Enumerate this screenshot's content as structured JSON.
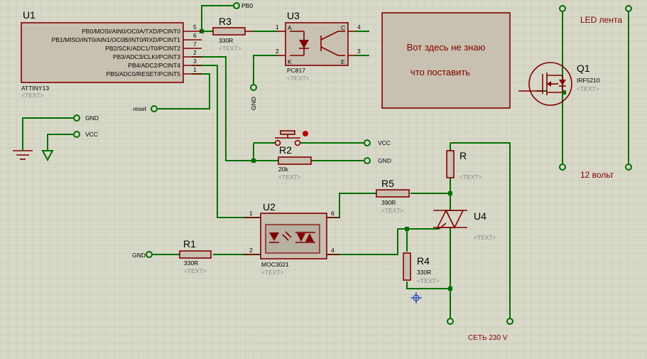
{
  "colors": {
    "background": "#d8d8c8",
    "grid": "#c6c6b6",
    "wire": "#007000",
    "component": "#800000",
    "component_fill": "#c8c0b0",
    "placeholder": "#8a8a8a"
  },
  "u1": {
    "ref": "U1",
    "part": "ATTINY13",
    "placeholder": "<TEXT>",
    "pins": [
      {
        "label": "PB0/MOSI/AIN0/OC0A/TXD/PCINT0",
        "num": "5"
      },
      {
        "label": "PB1/MISO/INT0/AIN1/OC0B/INT0/RXD/PCINT1",
        "num": "6"
      },
      {
        "label": "PB2/SCK/ADC1/T0/PCINT2",
        "num": "7"
      },
      {
        "label": "PB3/ADC3/CLKI/PCINT3",
        "num": "2"
      },
      {
        "label": "PB4/ADC2/PCINT4",
        "num": "3"
      },
      {
        "label": "PB5/ADC0/RESET/PCINT5",
        "num": "1"
      }
    ]
  },
  "r3": {
    "ref": "R3",
    "value": "330R",
    "placeholder": "<TEXT>"
  },
  "r2": {
    "ref": "R2",
    "value": "20k",
    "placeholder": "<TEXT>"
  },
  "r1": {
    "ref": "R1",
    "value": "330R",
    "placeholder": "<TEXT>"
  },
  "r5": {
    "ref": "R5",
    "value": "390R",
    "placeholder": "<TEXT>"
  },
  "r4": {
    "ref": "R4",
    "value": "330R",
    "placeholder": "<TEXT>"
  },
  "r": {
    "ref": "R",
    "placeholder": "<TEXT>"
  },
  "u3": {
    "ref": "U3",
    "part": "PC817",
    "placeholder": "<TEXT>",
    "pin_a": "A",
    "pin_k": "K",
    "pin_c": "C",
    "pin_e": "E",
    "n1": "1",
    "n2": "2",
    "n3": "3",
    "n4": "4"
  },
  "u2": {
    "ref": "U2",
    "part": "MOC3021",
    "placeholder": "<TEXT>",
    "n1": "1",
    "n2": "2",
    "n4": "4",
    "n6": "6"
  },
  "u4": {
    "ref": "U4",
    "placeholder": "<TEXT>"
  },
  "q1": {
    "ref": "Q1",
    "part": "IRF5210",
    "placeholder": "<TEXT>"
  },
  "terminals": {
    "pb0": "PB0",
    "gnd_u3": "GND",
    "gnd_left": "GND",
    "vcc_left": "VCC",
    "reset": "reset",
    "vcc_sw": "VCC",
    "gnd_r2": "GND",
    "gnd_r1": "GND"
  },
  "notes": {
    "box_line1": "Вот здесь не знаю",
    "box_line2": "что поставить",
    "led_strip": "LED лента",
    "volts": "12 вольт",
    "mains": "СЕТЬ 230 V"
  }
}
